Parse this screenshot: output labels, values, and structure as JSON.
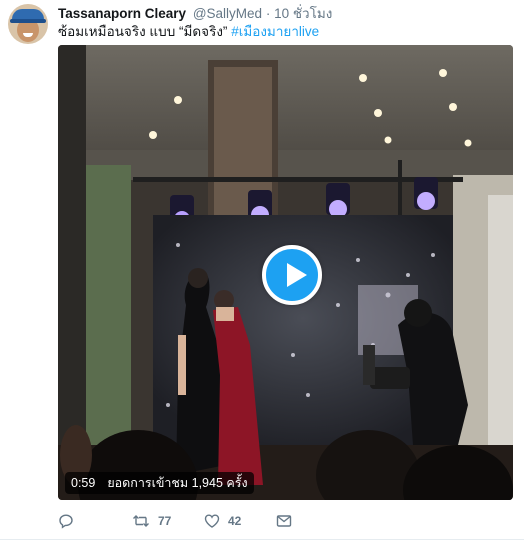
{
  "author": {
    "fullname": "Tassanaporn Cleary",
    "username": "@SallyMed",
    "separator": "·",
    "time": "10 ชั่วโมง"
  },
  "tweet": {
    "text": "ซ้อมเหมือนจริง แบบ “มีดจริง”",
    "hashtag": "#เมืองมายาlive"
  },
  "video": {
    "duration": "0:59",
    "views": "ยอดการเข้าชม 1,945 ครั้ง",
    "play_icon": "play-icon"
  },
  "actions": {
    "reply_icon": "reply-icon",
    "retweet_icon": "retweet-icon",
    "retweet_count": "77",
    "like_icon": "heart-icon",
    "like_count": "42",
    "dm_icon": "envelope-icon"
  },
  "colors": {
    "link": "#1da1f2",
    "muted": "#657786",
    "text": "#14171a",
    "play_button": "#1da1f2"
  }
}
